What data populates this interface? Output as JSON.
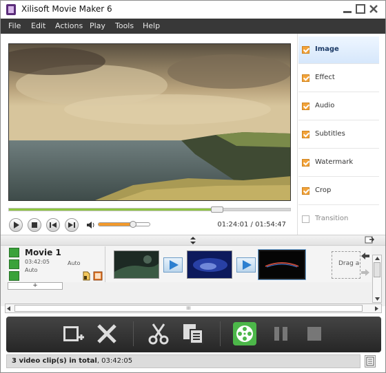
{
  "app": {
    "title": "Xilisoft Movie Maker 6"
  },
  "menu": [
    "File",
    "Edit",
    "Actions",
    "Play",
    "Tools",
    "Help"
  ],
  "player": {
    "current_time": "01:24:01",
    "total_time": "01:54:47",
    "seek_progress": 0.74,
    "volume": 0.66
  },
  "sidebar": {
    "items": [
      {
        "label": "Image",
        "checked": true,
        "active": true
      },
      {
        "label": "Effect",
        "checked": true,
        "active": false
      },
      {
        "label": "Audio",
        "checked": true,
        "active": false
      },
      {
        "label": "Subtitles",
        "checked": true,
        "active": false
      },
      {
        "label": "Watermark",
        "checked": true,
        "active": false
      },
      {
        "label": "Crop",
        "checked": true,
        "active": false
      },
      {
        "label": "Transition",
        "checked": false,
        "active": false
      }
    ]
  },
  "timeline": {
    "movie_title": "Movie 1",
    "movie_duration": "03:42:05",
    "auto_1": "Auto",
    "auto_2": "Auto",
    "add_label": "+",
    "drag_hint": "Drag a",
    "hscroll_grip": "III"
  },
  "toolbar": {
    "add_icon": "add-video-icon",
    "delete_icon": "delete-icon",
    "cut_icon": "scissors-icon",
    "edit_icon": "clip-edit-icon",
    "convert_icon": "film-reel-icon",
    "pause_icon": "pause-icon",
    "stop_icon": "stop-icon"
  },
  "status": {
    "text_bold": "3 video clip(s) in total",
    "text_time": ", 03:42:05"
  },
  "colors": {
    "menu_bg": "#383838",
    "progress_fill": "#8ec641",
    "volume_fill": "#f39a2b",
    "checkbox": "#f2a33a",
    "transition_arrow": "#2b7fd0",
    "toolbar_bg": "#2d2d2d",
    "convert_green": "#4cb749"
  }
}
